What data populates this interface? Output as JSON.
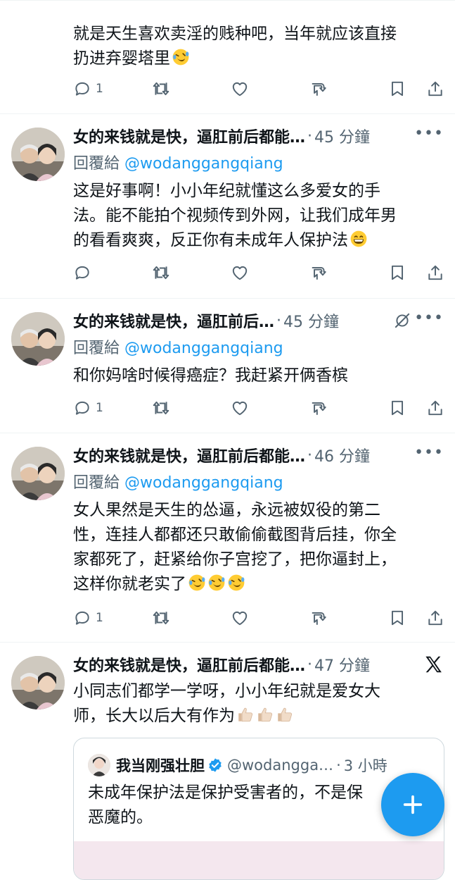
{
  "tweets": [
    {
      "text_lines": [
        "就是天生喜欢卖淫的贱种吧，当年就应该直接",
        "扔进弃婴塔里"
      ],
      "reply_count": "1"
    },
    {
      "name": "女的来钱就是快，逼肛前后都能…",
      "dot": "·",
      "time": "45 分鐘",
      "reply_prefix": "回覆給",
      "reply_handle": "@wodanggangqiang",
      "text_lines": [
        "这是好事啊！小小年纪就懂这么多爱女的手",
        "法。能不能拍个视频传到外网，让我们成年男",
        "的看看爽爽，反正你有未成年人保护法"
      ],
      "reply_count": ""
    },
    {
      "name": "女的来钱就是快，逼肛前后…",
      "dot": "·",
      "time": "45 分鐘",
      "reply_prefix": "回覆給",
      "reply_handle": "@wodanggangqiang",
      "text_lines": [
        "和你妈啥时候得癌症？我赶紧开俩香槟"
      ],
      "reply_count": "1"
    },
    {
      "name": "女的来钱就是快，逼肛前后都能…",
      "dot": "·",
      "time": "46 分鐘",
      "reply_prefix": "回覆給",
      "reply_handle": "@wodanggangqiang",
      "text_lines": [
        "女人果然是天生的怂逼，永远被奴役的第二",
        "性，连挂人都都还只敢偷偷截图背后挂，你全",
        "家都死了，赶紧给你子宫挖了，把你逼封上，",
        "这样你就老实了"
      ],
      "reply_count": "1"
    },
    {
      "name": "女的来钱就是快，逼肛前后都能…",
      "dot": "·",
      "time": "47 分鐘",
      "text_lines": [
        "小同志们都学一学呀，小小年纪就是爱女大",
        "师，长大以后大有作为"
      ],
      "quote": {
        "name": "我当刚强壮胆",
        "handle": "@wodangga…",
        "dot": "·",
        "time": "3 小時",
        "text_lines": [
          "未成年保护法是保护受害者的，不是保",
          "恶魔的。"
        ]
      }
    }
  ],
  "colors": {
    "accent": "#1d9bf0",
    "muted": "#536471",
    "text": "#0f1419"
  },
  "icons": [
    "reply-icon",
    "retweet-icon",
    "like-icon",
    "views-icon",
    "bookmark-icon",
    "share-icon",
    "more-icon",
    "muted-icon",
    "x-logo-icon",
    "verified-icon",
    "compose-plus-icon",
    "rofl-emoji-icon",
    "grin-emoji-icon",
    "thumbs-up-emoji-icon"
  ]
}
